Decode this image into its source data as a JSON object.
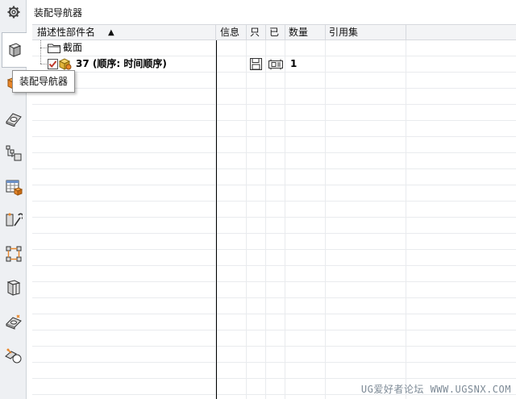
{
  "panel": {
    "title": "装配导航器"
  },
  "tooltip": {
    "text": "装配导航器"
  },
  "columns": {
    "name": "描述性部件名",
    "info": "信息",
    "readonly": "只",
    "modified": "已",
    "quantity": "数量",
    "refset": "引用集"
  },
  "sort_indicator": "▲",
  "tree": {
    "section_label": "截面",
    "root_label": "37 (顺序: 时间顺序)",
    "root_quantity": "1"
  },
  "left_toolbar": {
    "items": [
      "settings-gear",
      "assembly-navigator",
      "part-orange",
      "constraint-navigator",
      "part-navigator",
      "reuse-library",
      "hd3d-tools",
      "web-browser",
      "history",
      "process-studio",
      "roles"
    ]
  },
  "watermark": "UG爱好者论坛 WWW.UGSNX.COM",
  "colors": {
    "accent_orange": "#e8862a",
    "checkbox_red": "#c0392b",
    "header_bg": "#f3f4f6",
    "toolbar_bg": "#eef0f3"
  }
}
